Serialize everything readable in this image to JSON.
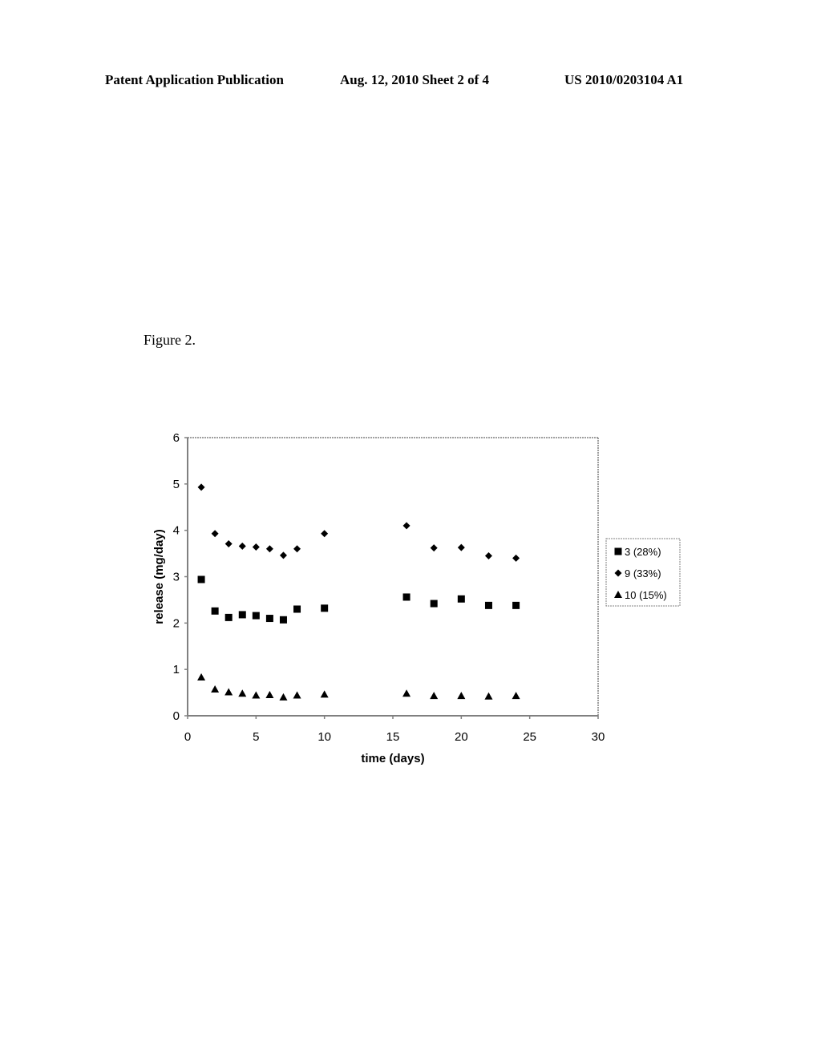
{
  "header": {
    "left": "Patent Application Publication",
    "middle": "Aug. 12, 2010  Sheet 2 of 4",
    "right": "US 2010/0203104 A1"
  },
  "figure_label": "Figure 2.",
  "chart_data": {
    "type": "scatter",
    "title": "",
    "xlabel": "time (days)",
    "ylabel": "release (mg/day)",
    "xlim": [
      0,
      30
    ],
    "ylim": [
      0,
      6
    ],
    "xticks": [
      0,
      5,
      10,
      15,
      20,
      25,
      30
    ],
    "yticks": [
      0,
      1,
      2,
      3,
      4,
      5,
      6
    ],
    "grid": false,
    "legend_position": "right",
    "series": [
      {
        "name": "3 (28%)",
        "marker": "square",
        "x": [
          1,
          2,
          3,
          4,
          5,
          6,
          7,
          8,
          10,
          16,
          18,
          20,
          22,
          24
        ],
        "y": [
          2.94,
          2.26,
          2.12,
          2.18,
          2.16,
          2.1,
          2.07,
          2.3,
          2.32,
          2.56,
          2.42,
          2.52,
          2.38,
          2.38
        ]
      },
      {
        "name": "9 (33%)",
        "marker": "diamond",
        "x": [
          1,
          2,
          3,
          4,
          5,
          6,
          7,
          8,
          10,
          16,
          18,
          20,
          22,
          24
        ],
        "y": [
          4.93,
          3.93,
          3.71,
          3.66,
          3.64,
          3.6,
          3.46,
          3.6,
          3.93,
          4.1,
          3.62,
          3.63,
          3.45,
          3.4
        ]
      },
      {
        "name": "10 (15%)",
        "marker": "triangle",
        "x": [
          1,
          2,
          3,
          4,
          5,
          6,
          7,
          8,
          10,
          16,
          18,
          20,
          22,
          24
        ],
        "y": [
          0.83,
          0.57,
          0.51,
          0.48,
          0.44,
          0.45,
          0.4,
          0.44,
          0.46,
          0.48,
          0.43,
          0.43,
          0.42,
          0.43
        ]
      }
    ]
  },
  "colors": {
    "marker": "#000000",
    "axis": "#808080",
    "background": "#ffffff"
  }
}
